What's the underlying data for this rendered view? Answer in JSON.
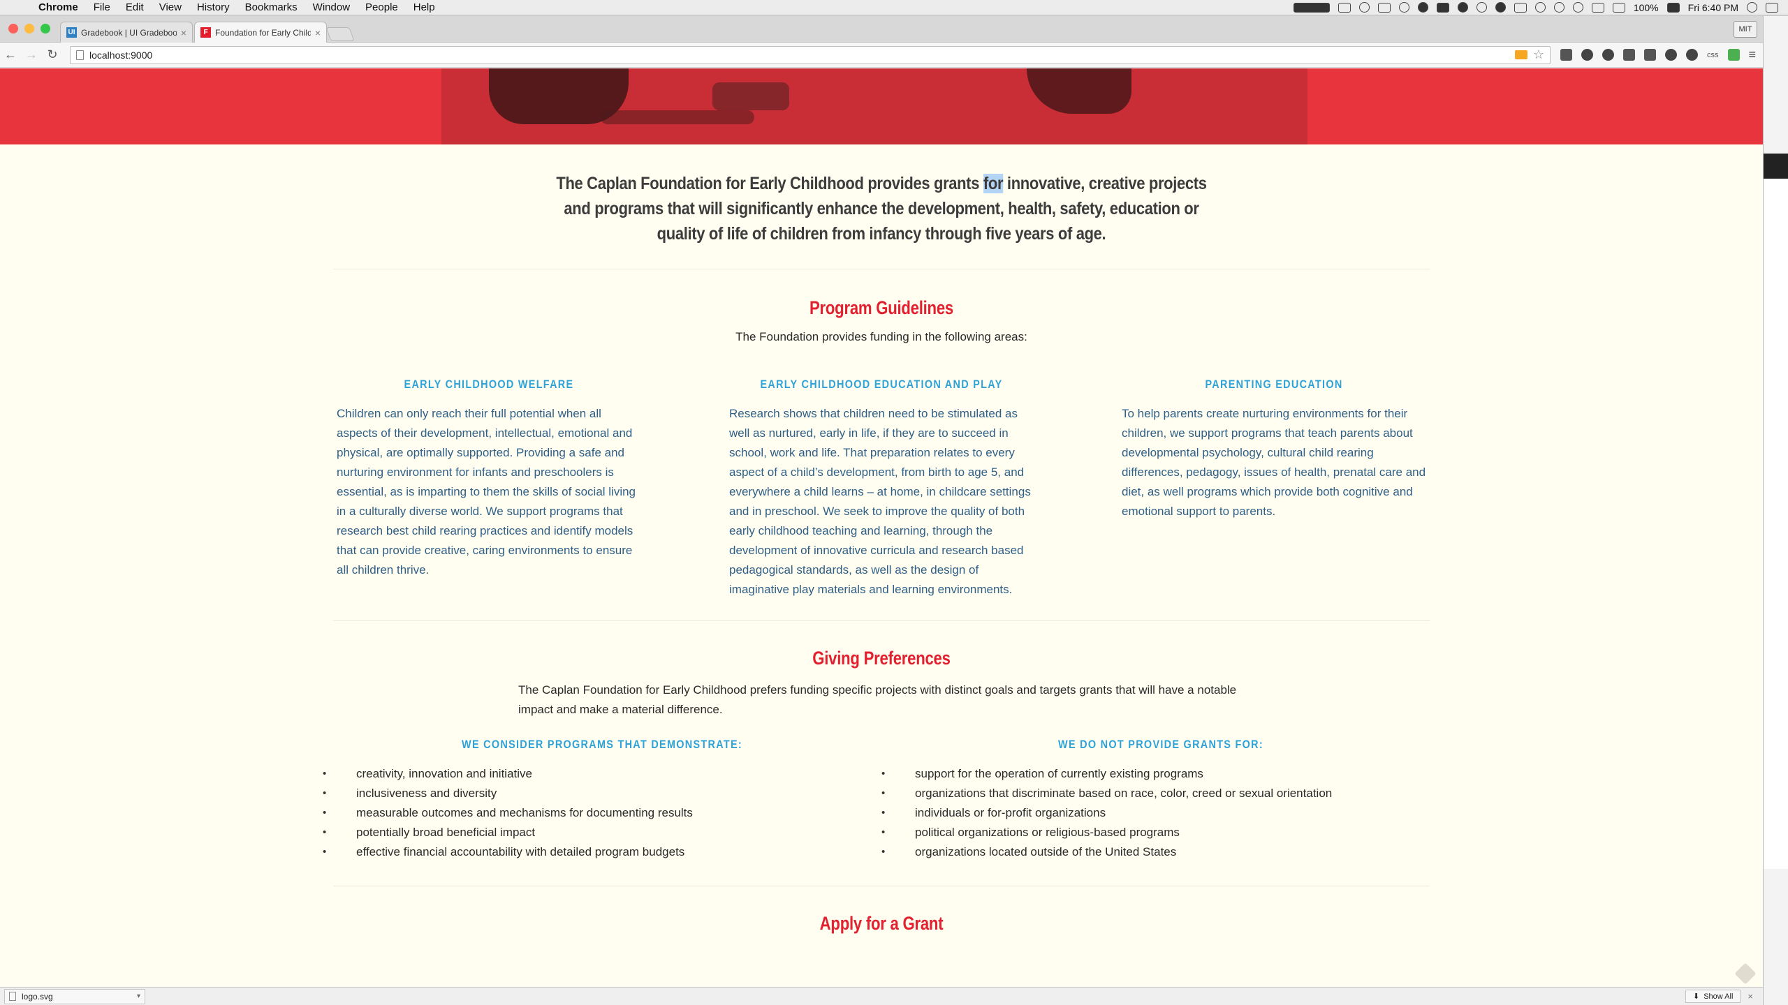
{
  "menubar": {
    "app": "Chrome",
    "items": [
      "File",
      "Edit",
      "View",
      "History",
      "Bookmarks",
      "Window",
      "People",
      "Help"
    ],
    "battery": "100%",
    "clock": "Fri 6:40 PM"
  },
  "browser": {
    "tabs": [
      {
        "title": "Gradebook | UI Gradebook",
        "favicon": "UI"
      },
      {
        "title": "Foundation for Early Childhood",
        "favicon": "F"
      }
    ],
    "profile": "MIT",
    "url": "localhost:9000"
  },
  "page": {
    "mission_pre": "The Caplan Foundation for Early Childhood provides grants ",
    "mission_highlight": "for",
    "mission_post": " innovative, creative projects and programs that will significantly enhance the development, health, safety, education or quality of life of children from infancy through five years of age.",
    "guidelines": {
      "title": "Program Guidelines",
      "subtitle": "The Foundation provides funding in the following areas:",
      "areas": [
        {
          "heading": "EARLY CHILDHOOD WELFARE",
          "text": "Children can only reach their full potential when all aspects of their development, intellectual, emotional and physical, are optimally supported. Providing a safe and nurturing environment for infants and preschoolers is essential, as is imparting to them the skills of social living in a culturally diverse world. We support programs that research best child rearing practices and identify models that can provide creative, caring environments to ensure all children thrive."
        },
        {
          "heading": "EARLY CHILDHOOD EDUCATION AND PLAY",
          "text": "Research shows that children need to be stimulated as well as nurtured, early in life, if they are to succeed in school, work and life. That preparation relates to every aspect of a child’s development, from birth to age 5, and everywhere a child learns – at home, in childcare settings and in preschool. We seek to improve the quality of both early childhood teaching and learning, through the development of innovative curricula and research based pedagogical standards, as well as the design of imaginative play materials and learning environments."
        },
        {
          "heading": "PARENTING EDUCATION",
          "text": "To help parents create nurturing environments for their children, we support programs that teach parents about developmental psychology, cultural child rearing differences, pedagogy, issues of health, prenatal care and diet, as well programs which provide both cognitive and emotional support to parents."
        }
      ]
    },
    "giving": {
      "title": "Giving Preferences",
      "intro": "The Caplan Foundation for Early Childhood prefers funding specific projects with distinct goals and targets grants that will have a notable impact and make a material difference.",
      "consider": {
        "heading": "WE CONSIDER PROGRAMS THAT DEMONSTRATE:",
        "items": [
          "creativity, innovation and initiative",
          "inclusiveness and diversity",
          "measurable outcomes and mechanisms for documenting results",
          "potentially broad beneficial impact",
          "effective financial accountability with detailed program budgets"
        ]
      },
      "exclude": {
        "heading": "WE DO NOT PROVIDE GRANTS FOR:",
        "items": [
          "support for the operation of currently existing programs",
          "organizations that discriminate based on race, color, creed or sexual orientation",
          "individuals or for-profit organizations",
          "political organizations or religious-based programs",
          "organizations located outside of the United States"
        ]
      }
    },
    "apply_title": "Apply for a Grant"
  },
  "downloads": {
    "file": "logo.svg",
    "show_all": "Show All"
  },
  "colors": {
    "accent_red": "#e3202f",
    "heading_blue": "#2fa3d8",
    "body_blue": "#2f5f86",
    "page_bg": "#fffef0"
  }
}
